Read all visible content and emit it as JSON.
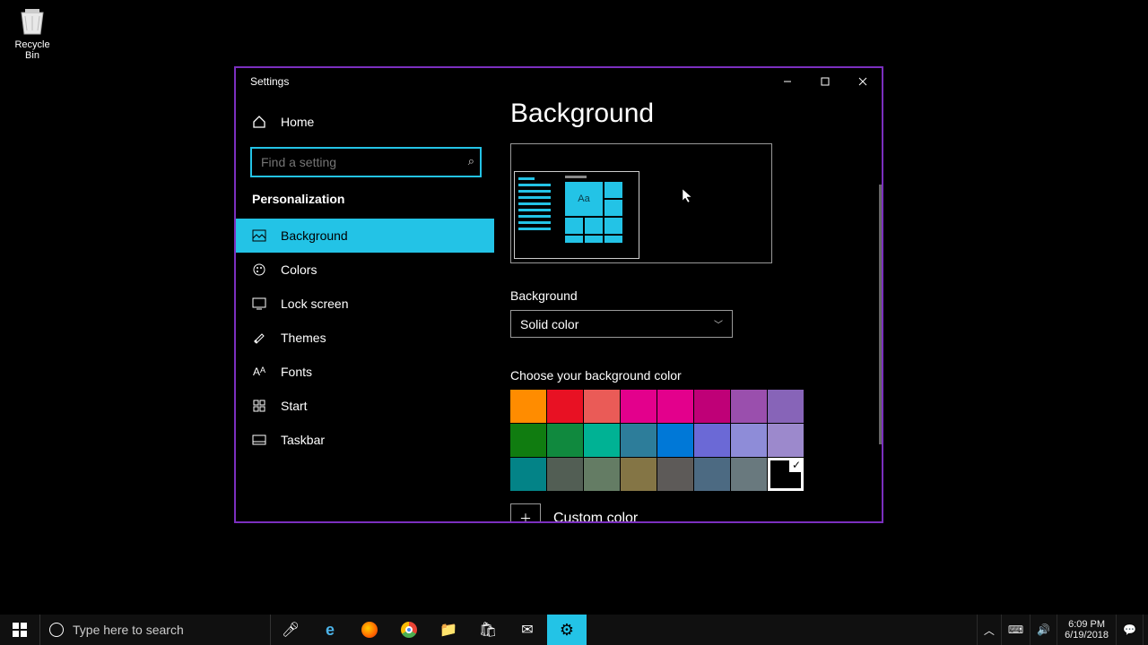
{
  "desktop": {
    "recycle_bin_label": "Recycle Bin"
  },
  "window": {
    "title": "Settings",
    "home_label": "Home",
    "search_placeholder": "Find a setting",
    "category": "Personalization",
    "sidebar": [
      {
        "label": "Background",
        "icon": "picture-icon",
        "active": true
      },
      {
        "label": "Colors",
        "icon": "palette-icon",
        "active": false
      },
      {
        "label": "Lock screen",
        "icon": "lock-screen-icon",
        "active": false
      },
      {
        "label": "Themes",
        "icon": "themes-icon",
        "active": false
      },
      {
        "label": "Fonts",
        "icon": "fonts-icon",
        "active": false
      },
      {
        "label": "Start",
        "icon": "start-icon",
        "active": false
      },
      {
        "label": "Taskbar",
        "icon": "taskbar-icon",
        "active": false
      }
    ],
    "page_heading": "Background",
    "preview_tile_text": "Aa",
    "background_field_label": "Background",
    "background_dropdown_value": "Solid color",
    "color_section_label": "Choose your background color",
    "custom_color_label": "Custom color",
    "colors": [
      "#ff8c00",
      "#e81123",
      "#ea5b57",
      "#e3008c",
      "#e3008c",
      "#bf0077",
      "#9a4fad",
      "#8764b8",
      "#107c10",
      "#10893e",
      "#00b294",
      "#2d7d9a",
      "#0078d7",
      "#6b69d6",
      "#8e8cd8",
      "#9c89cc",
      "#038387",
      "#525e54",
      "#647c64",
      "#847545",
      "#5d5a58",
      "#4c6a82",
      "#69797e",
      "#000000"
    ],
    "selected_color_index": 23
  },
  "taskbar": {
    "search_placeholder": "Type here to search",
    "time": "6:09 PM",
    "date": "6/19/2018"
  }
}
